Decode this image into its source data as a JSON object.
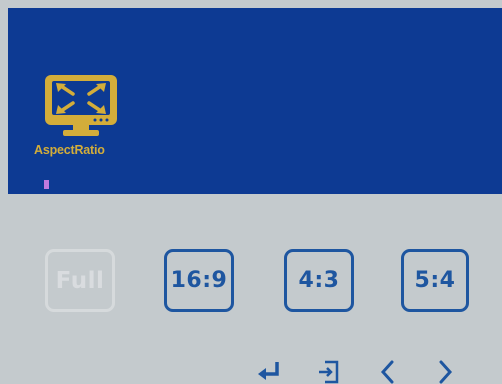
{
  "osd": {
    "menu": {
      "label": "AspectRatio",
      "icon": "aspect-ratio-icon"
    },
    "options": [
      {
        "label": "Full",
        "enabled": false
      },
      {
        "label": "16:9",
        "enabled": true
      },
      {
        "label": "4:3",
        "enabled": true
      },
      {
        "label": "5:4",
        "enabled": true
      }
    ],
    "nav": {
      "enter_icon": "enter-icon",
      "exit_icon": "exit-icon",
      "left_icon": "chevron-left-icon",
      "right_icon": "chevron-right-icon"
    }
  },
  "colors": {
    "top_panel": "#0d3a93",
    "bottom_panel": "#c4cacd",
    "accent_gold": "#d3ad3a",
    "option_blue": "#1e56a0",
    "disabled": "#d9dcdf",
    "indicator": "#c07adf"
  }
}
